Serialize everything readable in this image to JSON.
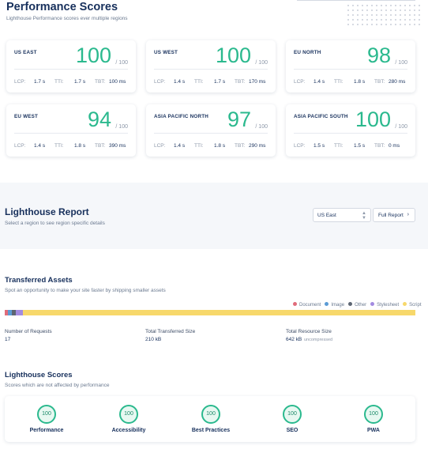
{
  "performance": {
    "title": "Performance Scores",
    "subtitle": "Lighthouse Performance scores ever multiple regions",
    "metric_labels": {
      "lcp": "LCP:",
      "tti": "TTI:",
      "tbt": "TBT:"
    },
    "regions": [
      {
        "name": "US EAST",
        "score": "100",
        "den": "/ 100",
        "lcp": "1.7 s",
        "tti": "1.7 s",
        "tbt": "100 ms"
      },
      {
        "name": "US WEST",
        "score": "100",
        "den": "/ 100",
        "lcp": "1.4 s",
        "tti": "1.7 s",
        "tbt": "170 ms"
      },
      {
        "name": "EU NORTH",
        "score": "98",
        "den": "/ 100",
        "lcp": "1.4 s",
        "tti": "1.8 s",
        "tbt": "280 ms"
      },
      {
        "name": "EU WEST",
        "score": "94",
        "den": "/ 100",
        "lcp": "1.4 s",
        "tti": "1.8 s",
        "tbt": "390 ms"
      },
      {
        "name": "ASIA PACIFIC NORTH",
        "score": "97",
        "den": "/ 100",
        "lcp": "1.4 s",
        "tti": "1.8 s",
        "tbt": "290 ms"
      },
      {
        "name": "ASIA PACIFIC SOUTH",
        "score": "100",
        "den": "/ 100",
        "lcp": "1.5 s",
        "tti": "1.5 s",
        "tbt": "0 ms"
      }
    ]
  },
  "report": {
    "title": "Lighthouse Report",
    "subtitle": "Select a region to see region specific details",
    "region_select": {
      "value": "US East",
      "icon": "updown-chevron-icon"
    },
    "full_report_label": "Full Report",
    "full_report_icon": "chevron-right-icon"
  },
  "assets": {
    "title": "Transferred Assets",
    "subtitle": "Spot an opportunity to make your site faster by shipping smaller assets",
    "legend": [
      {
        "label": "Document",
        "color": "#e06c7a"
      },
      {
        "label": "Image",
        "color": "#5b9bd5"
      },
      {
        "label": "Other",
        "color": "#5d6673"
      },
      {
        "label": "Stylesheet",
        "color": "#a38be0"
      },
      {
        "label": "Script",
        "color": "#f7d86b"
      }
    ],
    "bar_shares": [
      0.008,
      0.01,
      0.009,
      0.018,
      0.955
    ],
    "stats": {
      "requests_label": "Number of Requests",
      "requests_value": "17",
      "transfer_label": "Total Transferred Size",
      "transfer_value": "210 kB",
      "resource_label": "Total Resource Size",
      "resource_value": "642 kB",
      "resource_note": "uncompressed"
    }
  },
  "scores": {
    "title": "Lighthouse Scores",
    "subtitle": "Scores which are not affected by performance",
    "items": [
      {
        "label": "Performance",
        "value": "100"
      },
      {
        "label": "Accessibility",
        "value": "100"
      },
      {
        "label": "Best Practices",
        "value": "100"
      },
      {
        "label": "SEO",
        "value": "100"
      },
      {
        "label": "PWA",
        "value": "100"
      }
    ]
  }
}
